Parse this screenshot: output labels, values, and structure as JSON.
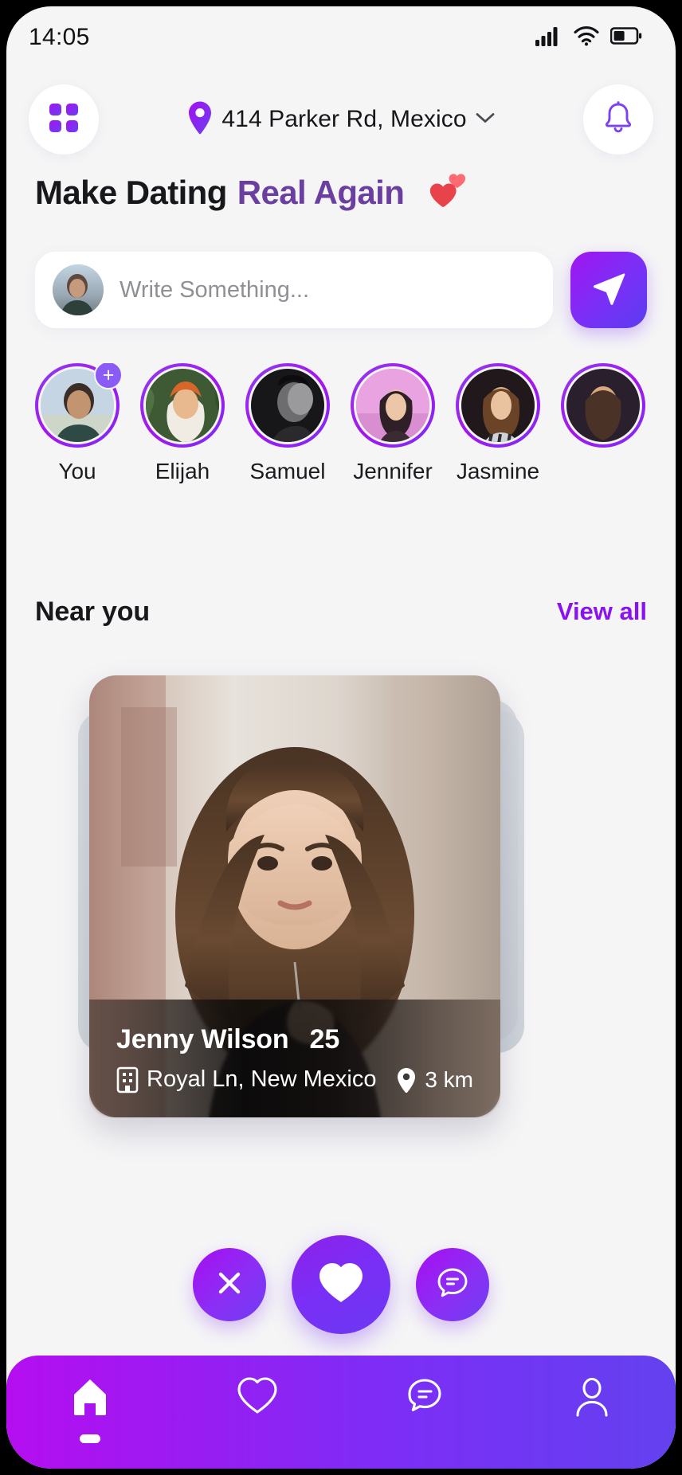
{
  "status_bar": {
    "time": "14:05",
    "signal_icon": "cellular-signal-icon",
    "wifi_icon": "wifi-icon",
    "battery_icon": "battery-icon"
  },
  "header": {
    "grid_button_icon": "grid-menu-icon",
    "location_pin_icon": "location-pin-icon",
    "location": "414 Parker Rd, Mexico",
    "chevron_icon": "chevron-down-icon",
    "bell_button_icon": "bell-notification-icon"
  },
  "title": {
    "part1": "Make Dating",
    "part2": "Real Again",
    "emoji_icon": "two-hearts-icon",
    "accent_color": "#6b3fa0"
  },
  "compose": {
    "avatar_icon": "user-avatar",
    "placeholder": "Write Something...",
    "value": "",
    "send_icon": "send-paper-plane-icon"
  },
  "stories": {
    "items": [
      {
        "name": "You",
        "has_add_badge": true,
        "add_badge_label": "+"
      },
      {
        "name": "Elijah",
        "has_add_badge": false
      },
      {
        "name": "Samuel",
        "has_add_badge": false
      },
      {
        "name": "Jennifer",
        "has_add_badge": false
      },
      {
        "name": "Jasmine",
        "has_add_badge": false
      },
      {
        "name": "",
        "has_add_badge": false
      }
    ]
  },
  "near_you": {
    "title": "Near you",
    "view_all": "View all",
    "view_all_color": "#8b12ef"
  },
  "profile_card": {
    "name": "Jenny Wilson",
    "age": "25",
    "address_icon": "building-icon",
    "address": "Royal Ln, New Mexico",
    "distance_icon": "location-pin-icon",
    "distance": "3 km"
  },
  "actions": {
    "dismiss_icon": "close-x-icon",
    "like_icon": "heart-filled-icon",
    "message_icon": "chat-bubble-icon"
  },
  "bottom_nav": {
    "items": [
      {
        "icon": "home-icon",
        "active": true
      },
      {
        "icon": "heart-outline-icon",
        "active": false
      },
      {
        "icon": "chat-outline-icon",
        "active": false
      },
      {
        "icon": "profile-person-icon",
        "active": false
      }
    ],
    "gradient_start": "#b50ef0",
    "gradient_end": "#6341ef"
  }
}
